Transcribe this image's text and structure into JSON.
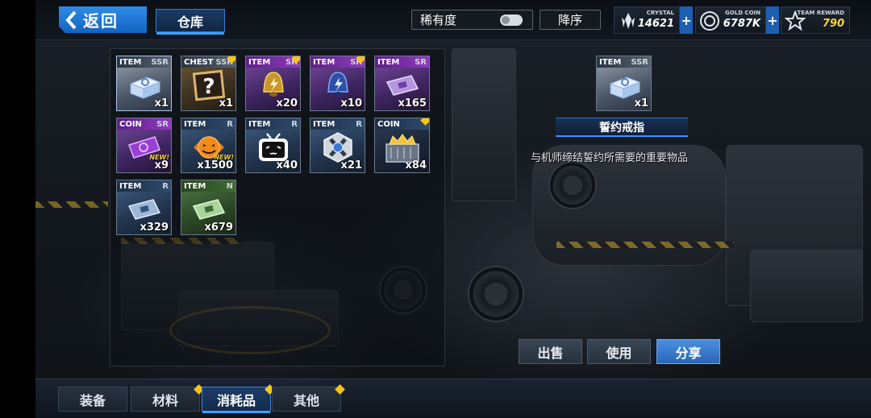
{
  "header": {
    "back_label": "返回",
    "warehouse_tab": "仓库",
    "sort_rarity_label": "稀有度",
    "sort_order_label": "降序",
    "currencies": [
      {
        "name": "CRYSTAL",
        "value": "14621",
        "icon": "crystal-icon",
        "value_color": "#ffffff"
      },
      {
        "name": "GOLD COIN",
        "value": "6787K",
        "icon": "gold-coin-icon",
        "value_color": "#ffffff"
      },
      {
        "name": "TEAM REWARD",
        "value": "790",
        "icon": "team-reward-icon",
        "value_color": "#ffd23a"
      }
    ],
    "plus_label": "+"
  },
  "inventory": {
    "items": [
      {
        "type": "ITEM",
        "rarity": "SSR",
        "qty": "x1",
        "icon": "ring-box-icon",
        "new": ""
      },
      {
        "type": "CHEST",
        "rarity": "SSR",
        "qty": "x1",
        "icon": "mystery-chest-icon",
        "new": ""
      },
      {
        "type": "ITEM",
        "rarity": "SR",
        "qty": "x20",
        "icon": "gold-bell-icon",
        "new": ""
      },
      {
        "type": "ITEM",
        "rarity": "SR",
        "qty": "x10",
        "icon": "blue-bell-icon",
        "new": ""
      },
      {
        "type": "ITEM",
        "rarity": "SR",
        "qty": "x165",
        "icon": "purple-card-icon",
        "new": ""
      },
      {
        "type": "COIN",
        "rarity": "SR",
        "qty": "x9",
        "icon": "purple-ticket-icon",
        "new": "NEW!"
      },
      {
        "type": "ITEM",
        "rarity": "R",
        "qty": "x1500",
        "icon": "pumpkin-candy-icon",
        "new": "NEW!"
      },
      {
        "type": "ITEM",
        "rarity": "R",
        "qty": "x40",
        "icon": "bilibili-tv-icon",
        "new": ""
      },
      {
        "type": "ITEM",
        "rarity": "R",
        "qty": "x21",
        "icon": "gear-cube-icon",
        "new": ""
      },
      {
        "type": "COIN",
        "rarity": "",
        "qty": "x84",
        "icon": "gold-crate-icon",
        "new": ""
      },
      {
        "type": "ITEM",
        "rarity": "R",
        "qty": "x329",
        "icon": "blue-card-icon",
        "new": ""
      },
      {
        "type": "ITEM",
        "rarity": "N",
        "qty": "x679",
        "icon": "green-card-icon",
        "new": ""
      }
    ]
  },
  "detail": {
    "type": "ITEM",
    "rarity": "SSR",
    "qty": "x1",
    "name": "誓约戒指",
    "description": "与机师缔结誓约所需要的重要物品"
  },
  "actions": {
    "sell": "出售",
    "use": "使用",
    "share": "分享"
  },
  "bottom_tabs": [
    {
      "label": "装备"
    },
    {
      "label": "材料"
    },
    {
      "label": "消耗品"
    },
    {
      "label": "其他"
    }
  ]
}
